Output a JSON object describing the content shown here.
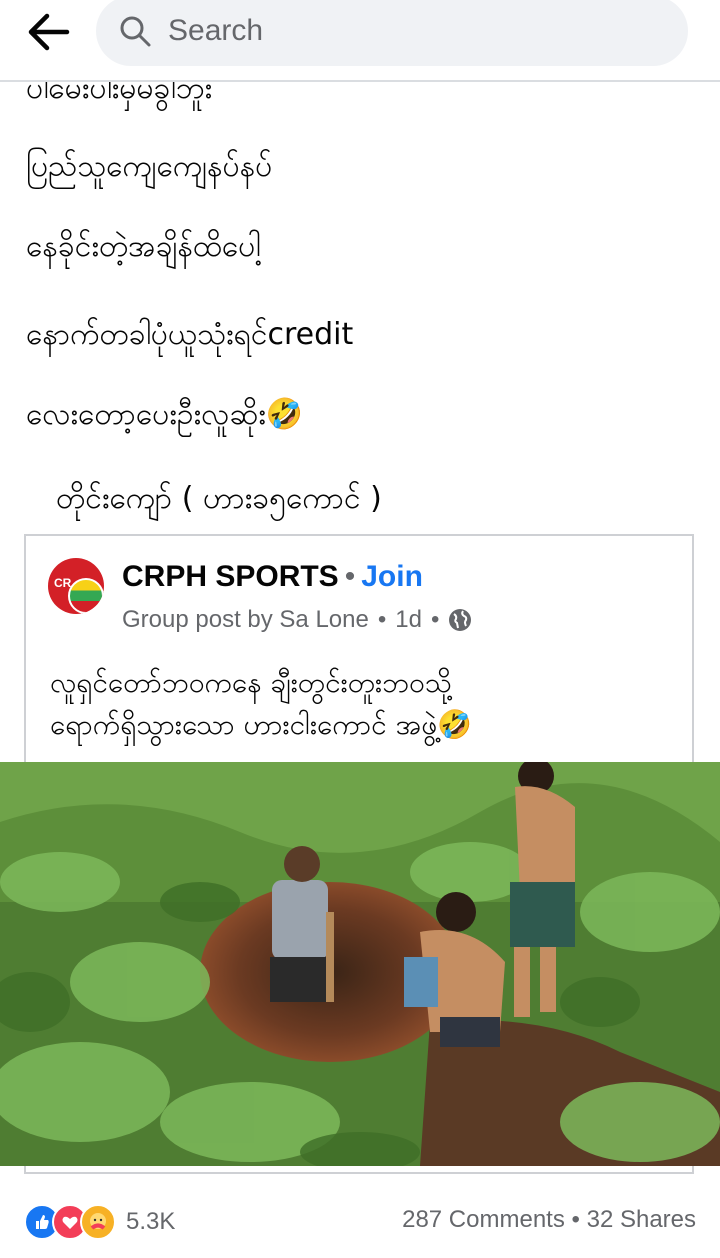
{
  "search": {
    "placeholder": "Search"
  },
  "post": {
    "lines": [
      "ပါမေးပါးမှမခွါဘူး",
      "ပြည်သူကျေကျေနပ်နပ်",
      "နေခိုင်းတဲ့အချိန်ထိပေါ့",
      "နောက်တခါပုံယူသုံးရင်credit",
      "လေးတော့ပေးဦးလူဆိုး🤣",
      "တိုင်းကျော် ( ဟားခ၅ကောင် )"
    ]
  },
  "shared_post": {
    "group_name": "CRPH SPORTS",
    "join_label": "Join",
    "meta_text": "Group post by Sa Lone",
    "time": "1d",
    "body_lines": [
      "လူရှင်တော်ဘဝကနေ ချီးတွင်းတူးဘဝသို့",
      "ရောက်ရှိသွားသော ဟားငါးကောင် အဖွဲ့🤣"
    ]
  },
  "footer": {
    "reaction_count": "5.3K",
    "comments": "287 Comments",
    "shares": "32 Shares"
  },
  "colors": {
    "accent": "#1877f2",
    "muted": "#65676b"
  }
}
